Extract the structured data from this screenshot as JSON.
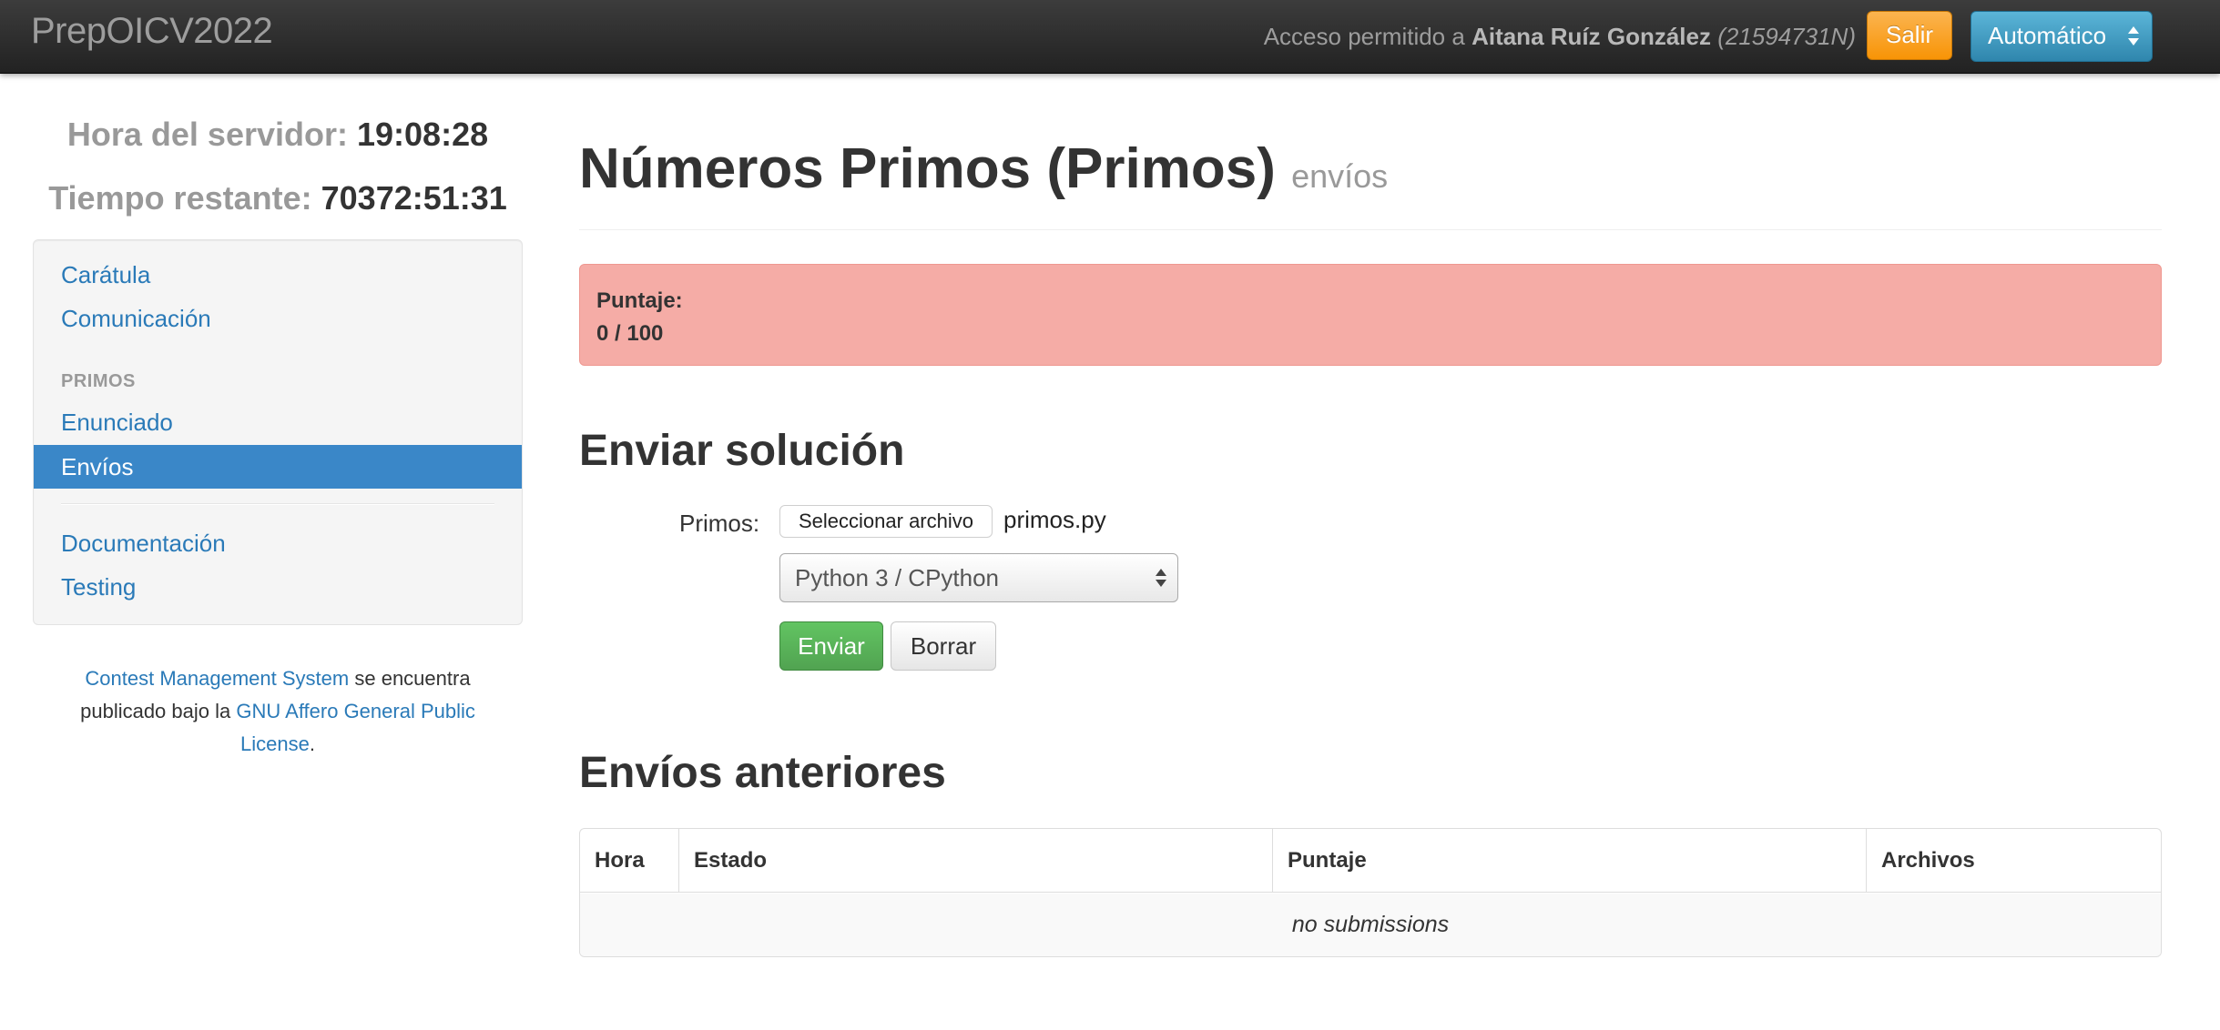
{
  "navbar": {
    "brand": "PrepOICV2022",
    "access_prefix": "Acceso permitido a",
    "user_name": "Aitana Ruíz González",
    "user_id": "(21594731N)",
    "logout_label": "Salir",
    "language_selected": "Automático"
  },
  "sidebar": {
    "server_time_label": "Hora del servidor:",
    "server_time_value": "19:08:28",
    "remaining_label": "Tiempo restante:",
    "remaining_value": "70372:51:31",
    "items": [
      {
        "label": "Carátula"
      },
      {
        "label": "Comunicación"
      },
      {
        "label": "Enunciado"
      },
      {
        "label": "Envíos"
      },
      {
        "label": "Documentación"
      },
      {
        "label": "Testing"
      }
    ],
    "section_header": "PRIMOS",
    "active_item": "Envíos"
  },
  "footer": {
    "link1": "Contest Management System",
    "text1": "se encuentra publicado bajo la",
    "link2": "GNU Affero General Public License",
    "text2": "."
  },
  "main": {
    "title": "Números Primos (Primos)",
    "title_sub": "envíos",
    "score_label": "Puntaje:",
    "score_value": "0 / 100",
    "submit_heading": "Enviar solución",
    "file_label": "Primos:",
    "file_button": "Seleccionar archivo",
    "file_name": "primos.py",
    "language_selected": "Python 3 / CPython",
    "submit_button": "Enviar",
    "reset_button": "Borrar",
    "previous_heading": "Envíos anteriores",
    "table": {
      "columns": [
        "Hora",
        "Estado",
        "Puntaje",
        "Archivos"
      ],
      "empty_text": "no submissions"
    }
  },
  "colors": {
    "navbar_bg": "#222222",
    "link": "#2a7ab8",
    "active_nav": "#3a87c8",
    "alert_danger": "#f5aca6",
    "btn_warning": "#f89406",
    "btn_info": "#2f86ad",
    "btn_success": "#51a351"
  }
}
